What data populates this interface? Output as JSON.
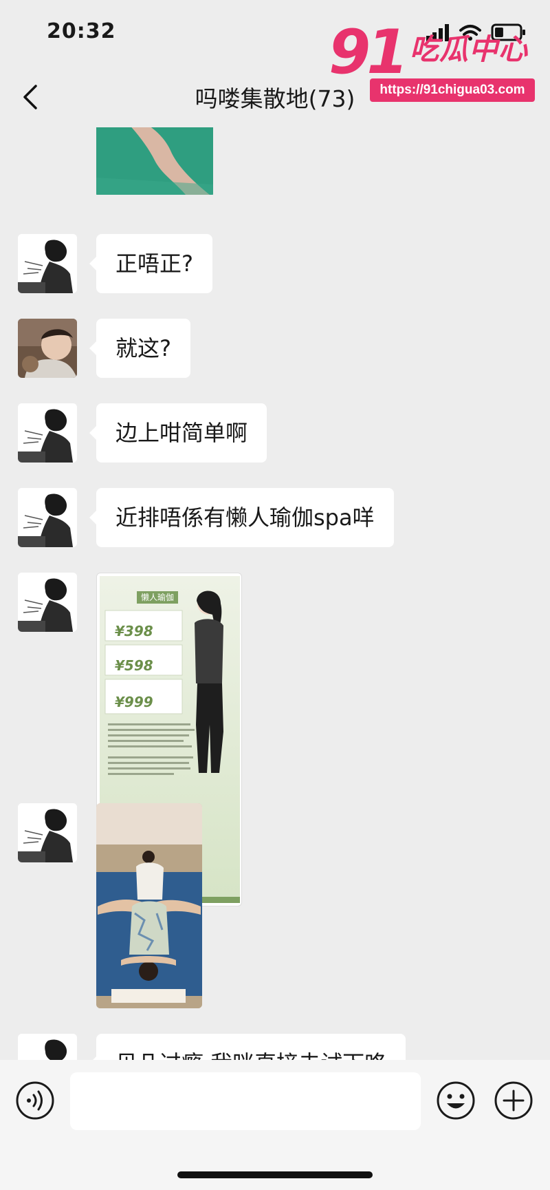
{
  "status_bar": {
    "time": "20:32",
    "battery_level": 0.35
  },
  "nav": {
    "title": "吗喽集散地(73)"
  },
  "watermark": {
    "number": "91",
    "text": "吃瓜中心",
    "url": "https://91chigua03.com"
  },
  "messages": [
    {
      "type": "image",
      "content": "leg-photo"
    },
    {
      "type": "text",
      "avatar": "manga-avatar",
      "text": "正唔正?"
    },
    {
      "type": "text",
      "avatar": "photo-avatar",
      "text": "就这?"
    },
    {
      "type": "text",
      "avatar": "manga-avatar",
      "text": "边上咁简单啊"
    },
    {
      "type": "text",
      "avatar": "manga-avatar",
      "text": "近排唔係有懒人瑜伽spa咩"
    },
    {
      "type": "image",
      "avatar": "manga-avatar",
      "content": "spa-poster",
      "poster": {
        "title": "懒人瑜伽",
        "prices": [
          "¥398",
          "¥598",
          "¥999"
        ]
      }
    },
    {
      "type": "image",
      "avatar": "manga-avatar",
      "content": "yoga-photo"
    },
    {
      "type": "text",
      "avatar": "manga-avatar",
      "text": "贝几过瘾 我咪直接去试下咯"
    }
  ],
  "colors": {
    "background": "#ededed",
    "bubble": "#ffffff",
    "watermark": "#e8336d"
  }
}
